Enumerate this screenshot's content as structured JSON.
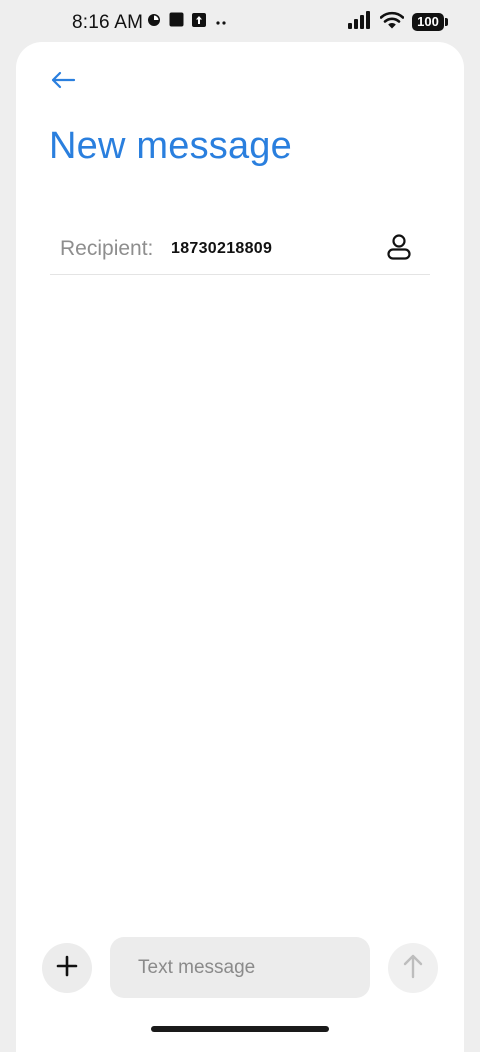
{
  "status_bar": {
    "time": "8:16 AM",
    "left_icons": [
      "pie-chart-icon",
      "stop-square-icon",
      "upload-box-icon",
      "more-dots-icon"
    ],
    "right_icons": [
      "signal-bars-icon",
      "wifi-icon",
      "battery-icon"
    ],
    "battery_level": "100"
  },
  "header": {
    "back_icon": "arrow-left-icon",
    "title": "New message"
  },
  "recipient": {
    "label": "Recipient:",
    "value": "18730218809",
    "contact_icon": "person-icon"
  },
  "composer": {
    "add_icon": "plus-icon",
    "placeholder": "Text message",
    "send_icon": "arrow-up-icon"
  },
  "colors": {
    "accent": "#2a7fde",
    "background": "#eeeeee",
    "surface": "#ffffff",
    "input_fill": "#ececec"
  }
}
